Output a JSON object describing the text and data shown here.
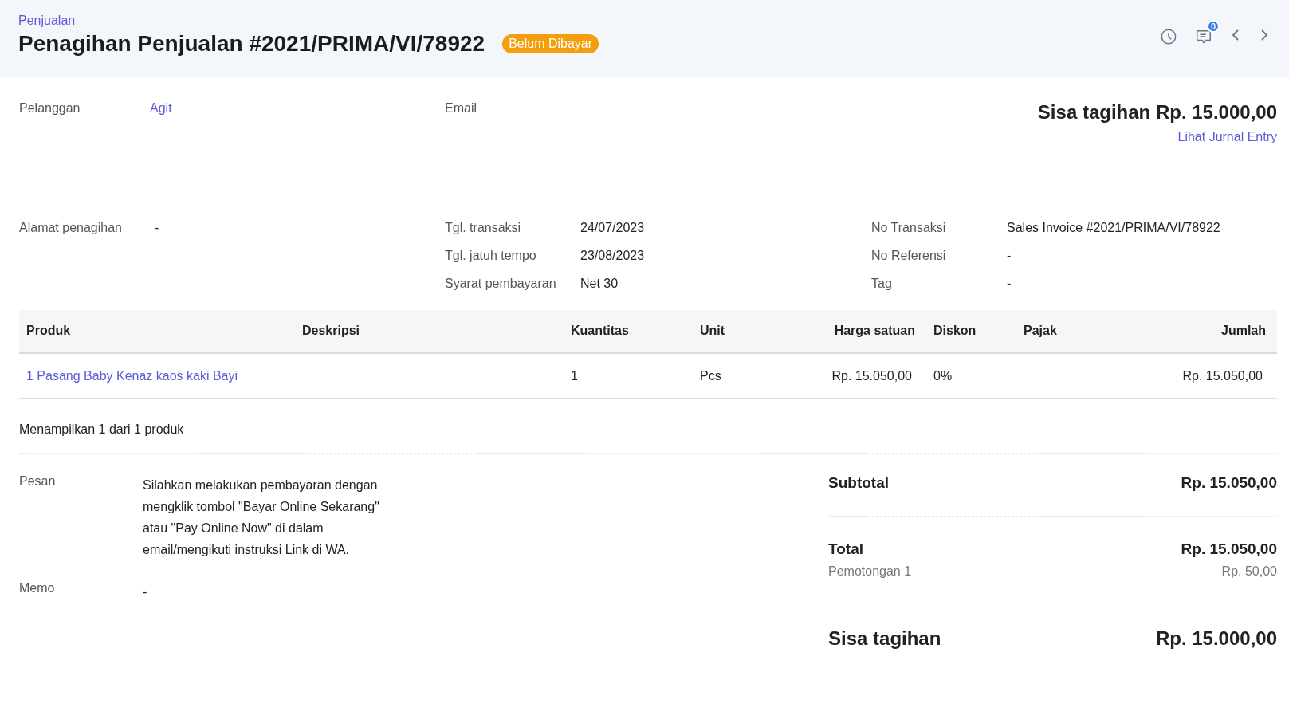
{
  "breadcrumb": "Penjualan",
  "title": "Penagihan Penjualan #2021/PRIMA/VI/78922",
  "status": {
    "label": "Belum Dibayar",
    "color": "#f59e0b"
  },
  "header_actions": {
    "notification_count": "0"
  },
  "customer": {
    "label": "Pelanggan",
    "value": "Agit"
  },
  "email": {
    "label": "Email"
  },
  "balance_heading": "Sisa tagihan Rp. 15.000,00",
  "journal_link": "Lihat Jurnal Entry",
  "details": [
    [
      {
        "label": "Alamat penagihan",
        "value": "-"
      }
    ],
    [
      {
        "label": "Tgl. transaksi",
        "value": "24/07/2023"
      },
      {
        "label": "Tgl. jatuh tempo",
        "value": "23/08/2023"
      },
      {
        "label": "Syarat pembayaran",
        "value": "Net 30"
      }
    ],
    [
      {
        "label": "No Transaksi",
        "value": "Sales Invoice #2021/PRIMA/VI/78922"
      },
      {
        "label": "No Referensi",
        "value": "-"
      },
      {
        "label": "Tag",
        "value": "-"
      }
    ]
  ],
  "table": {
    "columns": [
      "Produk",
      "Deskripsi",
      "Kuantitas",
      "Unit",
      "Harga satuan",
      "Diskon",
      "Pajak",
      "Jumlah"
    ],
    "rows": [
      {
        "cells": [
          "1 Pasang Baby Kenaz kaos kaki Bayi",
          "",
          "1",
          "Pcs",
          "Rp. 15.050,00",
          "0%",
          "",
          "Rp. 15.050,00"
        ]
      }
    ]
  },
  "table_footer": "Menampilkan 1 dari 1 produk",
  "notes": [
    {
      "label": "Pesan",
      "value": "Silahkan melakukan pembayaran dengan mengklik tombol \"Bayar Online Sekarang\" atau \"Pay Online Now\" di dalam email/mengikuti instruksi Link di WA."
    },
    {
      "label": "Memo",
      "value": "-"
    }
  ],
  "summary": [
    {
      "kind": "subtotal",
      "label": "Subtotal",
      "value": "Rp. 15.050,00"
    },
    {
      "kind": "total",
      "label": "Total",
      "value": "Rp. 15.050,00"
    },
    {
      "kind": "deduction",
      "label": "Pemotongan 1",
      "value": "Rp. 50,00"
    },
    {
      "kind": "balance",
      "label": "Sisa tagihan",
      "value": "Rp. 15.000,00"
    }
  ]
}
